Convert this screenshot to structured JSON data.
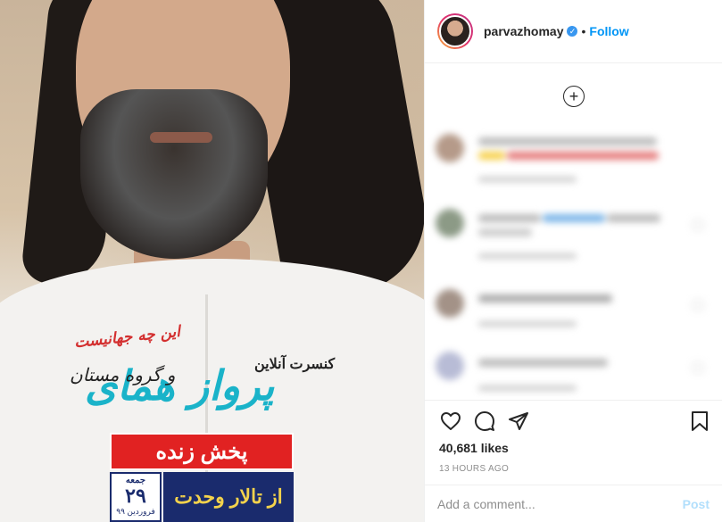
{
  "post": {
    "poster": {
      "title_red": "این چه جهانیست",
      "concert_label": "کنسرت آنلاین",
      "main_title": "پرواز همای",
      "group_label": "و گروه مستان",
      "live_label": "پخش زنده",
      "date_day": "جمعه",
      "date_num": "۲۹",
      "date_month": "فروردین ۹۹",
      "venue_label": "از تالار وحدت"
    }
  },
  "header": {
    "username": "parvazhomay",
    "separator": "•",
    "follow_label": "Follow",
    "more_label": "···"
  },
  "comments": {
    "load_more_icon": "plus-circle-icon"
  },
  "actions": {
    "like_icon": "heart-icon",
    "comment_icon": "comment-icon",
    "share_icon": "share-icon",
    "save_icon": "bookmark-icon"
  },
  "stats": {
    "likes": "40,681 likes",
    "time": "13 HOURS AGO"
  },
  "comment_box": {
    "placeholder": "Add a comment...",
    "post_label": "Post"
  }
}
